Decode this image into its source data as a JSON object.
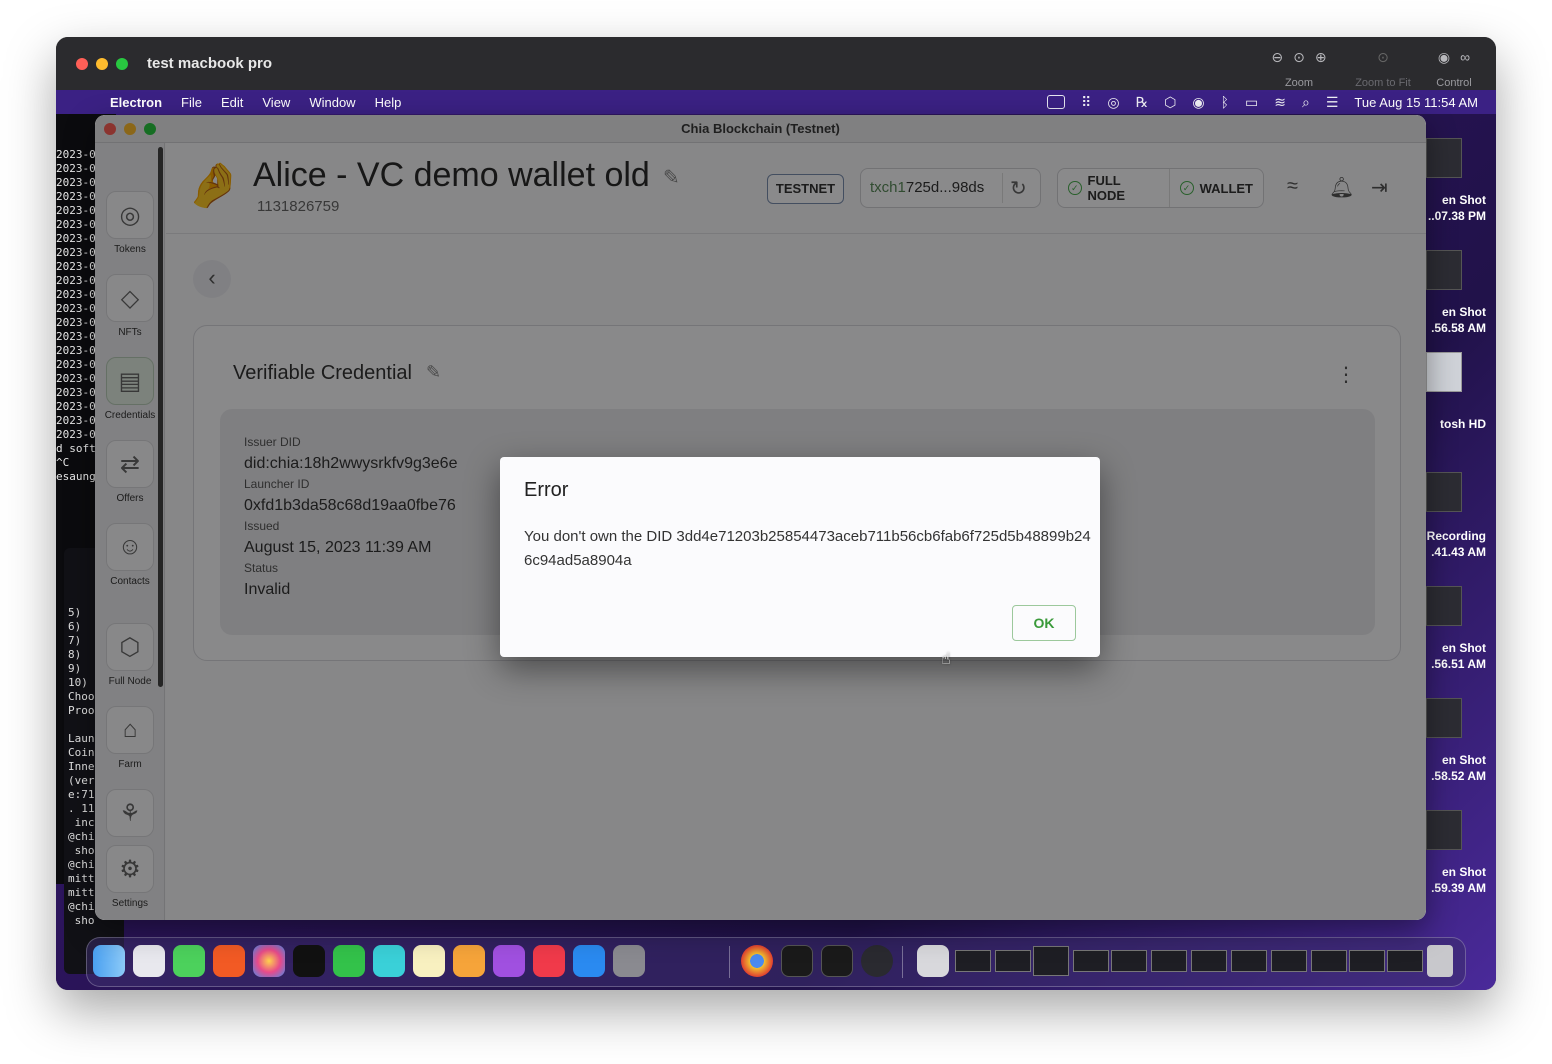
{
  "outer": {
    "title": "test macbook pro",
    "zoom_label": "Zoom",
    "zoom_to_fit_label": "Zoom to Fit",
    "control_label": "Control"
  },
  "menubar": {
    "app": "Electron",
    "items": [
      "File",
      "Edit",
      "View",
      "Window",
      "Help"
    ],
    "datetime": "Tue Aug 15  11:54 AM"
  },
  "terminal": {
    "lines": "2023-0\n2023-0\n2023-0\n2023-0\n2023-0\n2023-0\n2023-0\n2023-0\n2023-0\n2023-0\n2023-0\n2023-0\n2023-0\n2023-0\n2023-0\n2023-0\n2023-0\n2023-0\n2023-0\n2023-0\n2023-0\nd soft\n^C\nesaung",
    "lines2": "5)\n6)\n7)\n8)\n9)\n10)\nChoo\nProo\n\nLaun\nCoin\nInne\n(ver\ne:71\n. 11\n inc\n@chi\n sho\n@chi\nmitt\nmitt\n@chi\n sho"
  },
  "desktop_icons": [
    {
      "line1": "en Shot",
      "line2": "..07.38 PM"
    },
    {
      "line1": "en Shot",
      "line2": ".56.58 AM"
    },
    {
      "line1": "tosh HD",
      "line2": ""
    },
    {
      "line1": "Recording",
      "line2": ".41.43 AM"
    },
    {
      "line1": "en Shot",
      "line2": ".56.51 AM"
    },
    {
      "line1": "en Shot",
      "line2": ".58.52 AM"
    },
    {
      "line1": "en Shot",
      "line2": ".59.39 AM"
    }
  ],
  "chia": {
    "window_title": "Chia Blockchain (Testnet)",
    "sidebar": [
      "Tokens",
      "NFTs",
      "Credentials",
      "Offers",
      "Contacts",
      "Full Node",
      "Farm",
      "",
      "Settings"
    ],
    "wallet_name": "Alice - VC demo wallet old",
    "wallet_id": "1131826759",
    "network_badge": "TESTNET",
    "address_prefix": "txch1",
    "address_rest": "725d...98ds",
    "full_node_label": "FULL NODE",
    "wallet_label": "WALLET",
    "card_title": "Verifiable Credential",
    "fields": {
      "issuer_did_label": "Issuer DID",
      "issuer_did_value": "did:chia:18h2wwysrkfv9g3e6e",
      "launcher_id_label": "Launcher ID",
      "launcher_id_value": "0xfd1b3da58c68d19aa0fbe76",
      "issued_label": "Issued",
      "issued_value": "August 15, 2023 11:39 AM",
      "status_label": "Status",
      "status_value": "Invalid"
    }
  },
  "dialog": {
    "title": "Error",
    "message": "You don't own the DID 3dd4e71203b25854473aceb711b56cb6fab6f725d5b48899b246c94ad5a8904a",
    "ok_label": "OK"
  },
  "colors": {
    "accent_green": "#3a9a3a",
    "menubar_purple": "#3b2184"
  }
}
